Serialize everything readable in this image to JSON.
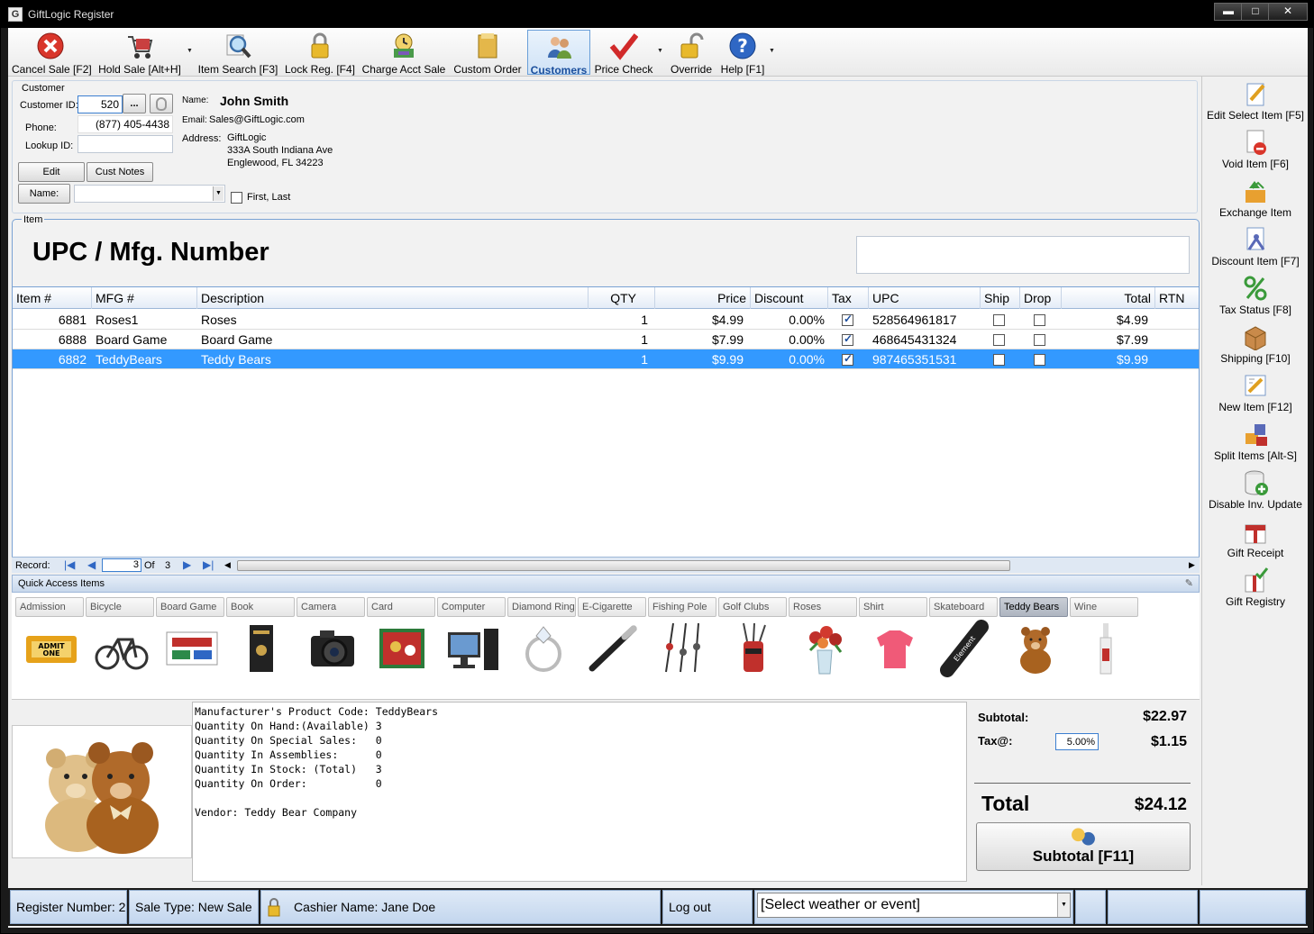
{
  "window": {
    "title": "GiftLogic Register",
    "app_icon": "G",
    "min": "▬",
    "max": "□",
    "close": "✕"
  },
  "toolbar": [
    {
      "label": "Cancel Sale [F2]",
      "icon": "cancel-icon"
    },
    {
      "label": "Hold Sale [Alt+H]",
      "icon": "cart-icon"
    },
    {
      "label": "Item Search [F3]",
      "icon": "search-icon"
    },
    {
      "label": "Lock Reg. [F4]",
      "icon": "lock-icon"
    },
    {
      "label": "Charge Acct Sale",
      "icon": "charge-icon"
    },
    {
      "label": "Custom Order",
      "icon": "folder-icon"
    },
    {
      "label": "Customers",
      "icon": "customers-icon"
    },
    {
      "label": "Price Check",
      "icon": "checkmark-icon"
    },
    {
      "label": "Override",
      "icon": "unlock-icon"
    },
    {
      "label": "Help [F1]",
      "icon": "help-icon"
    }
  ],
  "customer": {
    "group_label": "Customer",
    "id_label": "Customer ID:",
    "id_value": "520",
    "browse_label": "...",
    "phone_label": "Phone:",
    "phone_value": "(877) 405-4438",
    "lookup_label": "Lookup ID:",
    "lookup_value": "",
    "edit_label": "Edit",
    "notes_label": "Cust Notes",
    "name_btn_label": "Name:",
    "name_dropdown": "",
    "first_last_label": "First, Last",
    "name_key": "Name:",
    "name_value": "John Smith",
    "email_key": "Email:",
    "email_value": "Sales@GiftLogic.com",
    "address_key": "Address:",
    "address_lines": [
      "GiftLogic",
      "333A South Indiana Ave",
      "Englewood, FL   34223"
    ]
  },
  "item": {
    "group_label": "Item",
    "heading": "UPC / Mfg. Number",
    "input_value": ""
  },
  "grid": {
    "columns": [
      "Item #",
      "MFG #",
      "Description",
      "QTY",
      "Price",
      "Discount",
      "Tax",
      "UPC",
      "Ship",
      "Drop",
      "Total",
      "RTN"
    ],
    "rows": [
      {
        "item": "6881",
        "mfg": "Roses1",
        "desc": "Roses",
        "qty": "1",
        "price": "$4.99",
        "discount": "0.00%",
        "tax": true,
        "upc": "528564961817",
        "ship": false,
        "drop": false,
        "total": "$4.99"
      },
      {
        "item": "6888",
        "mfg": "Board Game",
        "desc": "Board Game",
        "qty": "1",
        "price": "$7.99",
        "discount": "0.00%",
        "tax": true,
        "upc": "468645431324",
        "ship": false,
        "drop": false,
        "total": "$7.99"
      },
      {
        "item": "6882",
        "mfg": "TeddyBears",
        "desc": "Teddy Bears",
        "qty": "1",
        "price": "$9.99",
        "discount": "0.00%",
        "tax": true,
        "upc": "987465351531",
        "ship": false,
        "drop": false,
        "total": "$9.99",
        "selected": true
      }
    ],
    "record_label": "Record:",
    "record_value": "3",
    "of_label": "Of",
    "of_total": "3"
  },
  "quick_access": {
    "title": "Quick Access Items",
    "pin_icon": "pin-icon",
    "items": [
      "Admission",
      "Bicycle",
      "Board Game",
      "Book",
      "Camera",
      "Card",
      "Computer",
      "Diamond Ring",
      "E-Cigarette",
      "Fishing Pole",
      "Golf Clubs",
      "Roses",
      "Shirt",
      "Skateboard",
      "Teddy Bears",
      "Wine"
    ],
    "selected": "Teddy Bears"
  },
  "details": {
    "lines": [
      "Manufacturer's Product Code: TeddyBears",
      "Quantity On Hand:(Available) 3",
      "Quantity On Special Sales:   0",
      "Quantity In Assemblies:      0",
      "Quantity In Stock: (Total)   3",
      "Quantity On Order:           0",
      "",
      "Vendor: Teddy Bear Company"
    ]
  },
  "totals": {
    "subtotal_label": "Subtotal:",
    "subtotal_value": "$22.97",
    "tax_label": "Tax@:",
    "tax_rate": "5.00%",
    "tax_value": "$1.15",
    "total_label": "Total",
    "total_value": "$24.12",
    "subtotal_button": "Subtotal [F11]"
  },
  "sidebar": [
    {
      "label": "Edit Select Item [F5]",
      "icon": "edit-icon"
    },
    {
      "label": "Void Item [F6]",
      "icon": "void-icon"
    },
    {
      "label": "Exchange Item",
      "icon": "exchange-icon"
    },
    {
      "label": "Discount Item [F7]",
      "icon": "discount-icon"
    },
    {
      "label": "Tax Status [F8]",
      "icon": "percent-icon"
    },
    {
      "label": "Shipping [F10]",
      "icon": "box-icon"
    },
    {
      "label": "New Item [F12]",
      "icon": "new-item-icon"
    },
    {
      "label": "Split Items [Alt-S]",
      "icon": "split-icon"
    },
    {
      "label": "Disable Inv. Update",
      "icon": "database-icon"
    },
    {
      "label": "Gift Receipt",
      "icon": "gift-receipt-icon"
    },
    {
      "label": "Gift Registry",
      "icon": "gift-registry-icon"
    }
  ],
  "status": {
    "register": "Register Number: 2",
    "sale_type": "Sale Type: New Sale",
    "cashier": "Cashier Name: Jane Doe",
    "logout": "Log out",
    "weather": "[Select weather or event]"
  },
  "colors": {
    "selection": "#3399ff",
    "accent": "#7aa2d4",
    "status_bg": "#c3d6ee"
  }
}
